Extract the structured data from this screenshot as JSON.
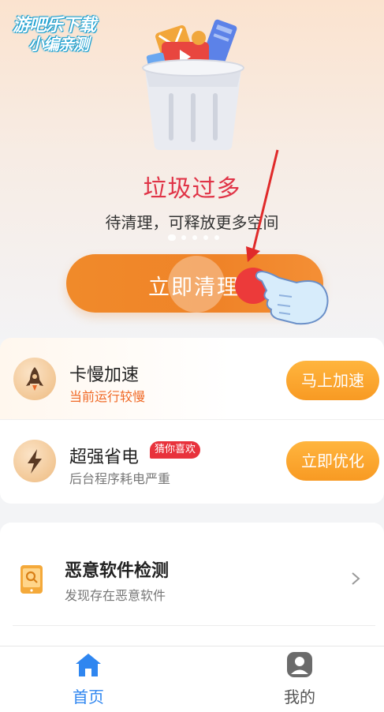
{
  "watermark": {
    "line1": "游吧乐下载",
    "line2": "小编亲测"
  },
  "hero": {
    "title": "垃圾过多",
    "subtitle": "待清理，可释放更多空间",
    "clean_button": "立即清理"
  },
  "features": [
    {
      "title": "卡慢加速",
      "subtitle": "当前运行较慢",
      "action": "马上加速",
      "icon": "rocket-icon"
    },
    {
      "title": "超强省电",
      "badge": "猜你喜欢",
      "subtitle": "后台程序耗电严重",
      "action": "立即优化",
      "icon": "lightning-icon"
    }
  ],
  "malware": {
    "title": "恶意软件检测",
    "subtitle": "发现存在恶意软件",
    "icon": "phone-scan-icon"
  },
  "tabbar": {
    "tabs": [
      {
        "label": "首页",
        "icon": "home-icon",
        "active": true
      },
      {
        "label": "我的",
        "icon": "profile-icon",
        "active": false
      }
    ]
  },
  "colors": {
    "accent_orange": "#f08a2a",
    "title_red": "#e03447",
    "badge_red": "#e8323c",
    "tab_active_blue": "#2f86f0"
  }
}
